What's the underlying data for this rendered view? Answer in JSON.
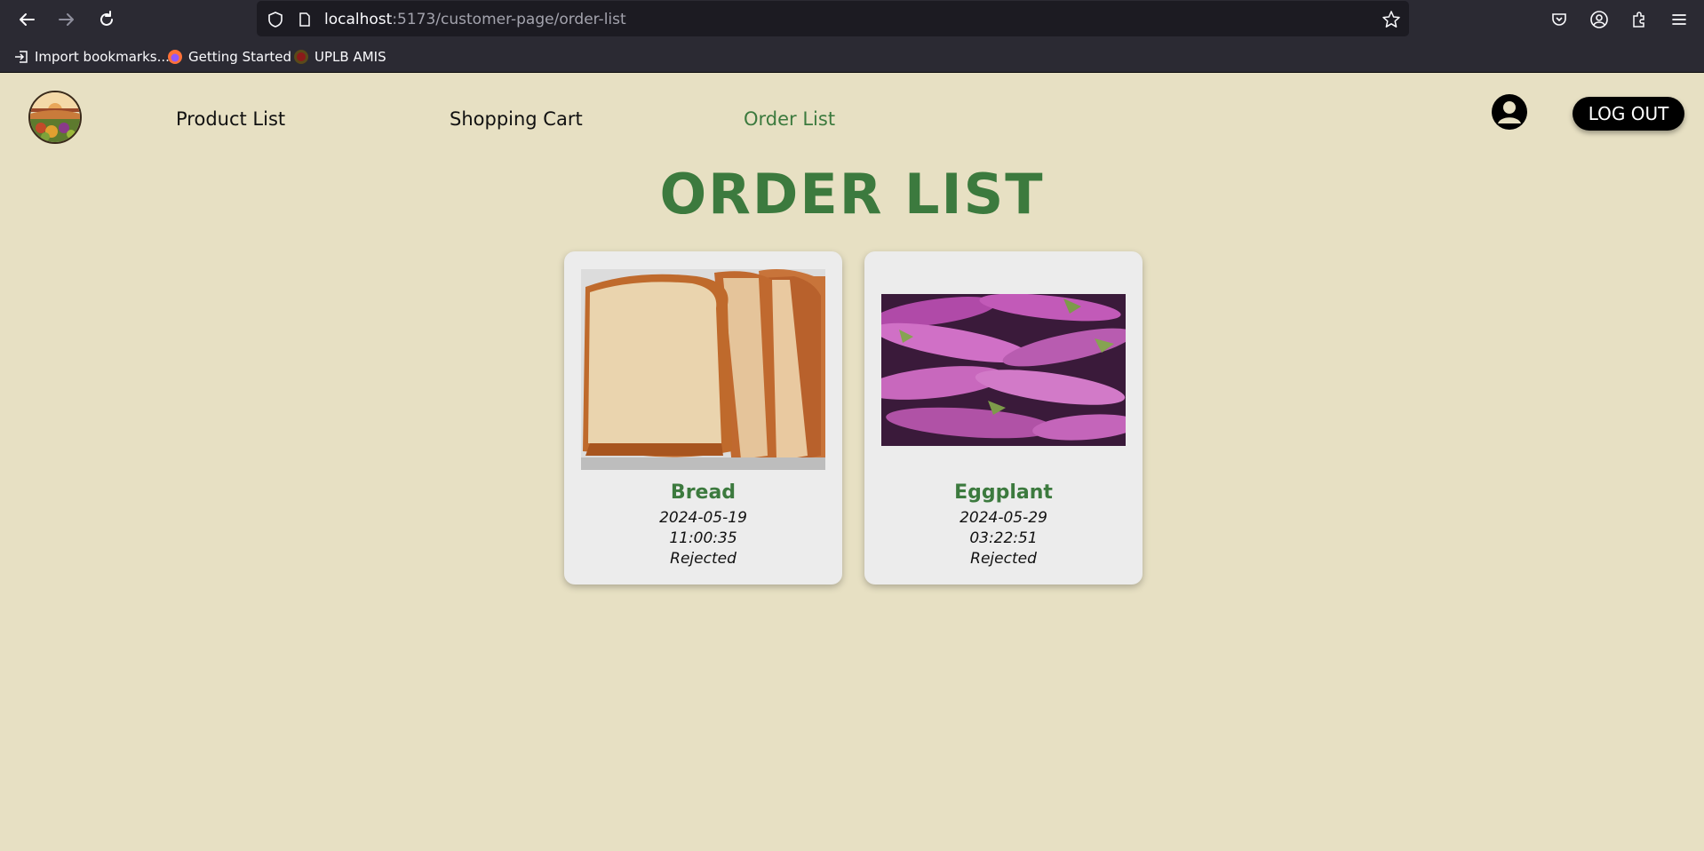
{
  "browser": {
    "url_host": "localhost",
    "url_path": ":5173/customer-page/order-list",
    "bookmarks": [
      {
        "label": "Import bookmarks...",
        "icon": "import-icon"
      },
      {
        "label": "Getting Started",
        "icon": "firefox-icon"
      },
      {
        "label": "UPLB AMIS",
        "icon": "uplb-icon"
      }
    ]
  },
  "nav": {
    "links": [
      "Product List",
      "Shopping Cart",
      "Order List"
    ],
    "active": "Order List",
    "logout_label": "LOG OUT",
    "accent_color": "#3c7a3e"
  },
  "main": {
    "title": "ORDER LIST",
    "orders": [
      {
        "name": "Bread",
        "date": "2024-05-19",
        "time": "11:00:35",
        "status": "Rejected",
        "image": "bread-image"
      },
      {
        "name": "Eggplant",
        "date": "2024-05-29",
        "time": "03:22:51",
        "status": "Rejected",
        "image": "eggplant-image"
      }
    ]
  }
}
